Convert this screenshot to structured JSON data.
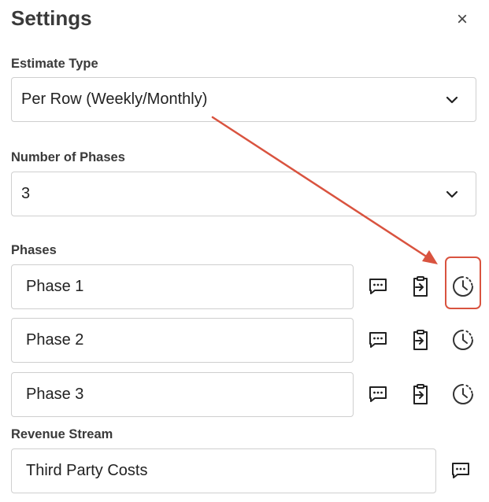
{
  "panel": {
    "title": "Settings",
    "close_symbol": "×"
  },
  "estimate_type": {
    "label": "Estimate Type",
    "value": "Per Row (Weekly/Monthly)"
  },
  "number_of_phases": {
    "label": "Number of Phases",
    "value": "3"
  },
  "phases": {
    "label": "Phases",
    "items": [
      {
        "name": "Phase 1",
        "highlighted": true
      },
      {
        "name": "Phase 2",
        "highlighted": false
      },
      {
        "name": "Phase 3",
        "highlighted": false
      }
    ],
    "icons": [
      "comment-icon",
      "clipboard-import-icon",
      "clock-icon"
    ]
  },
  "revenue_stream": {
    "label": "Revenue Stream",
    "value": "Third Party Costs",
    "icon": "comment-icon"
  },
  "annotation": {
    "arrow_color": "#d9533f",
    "highlight_color": "#d9533f"
  }
}
